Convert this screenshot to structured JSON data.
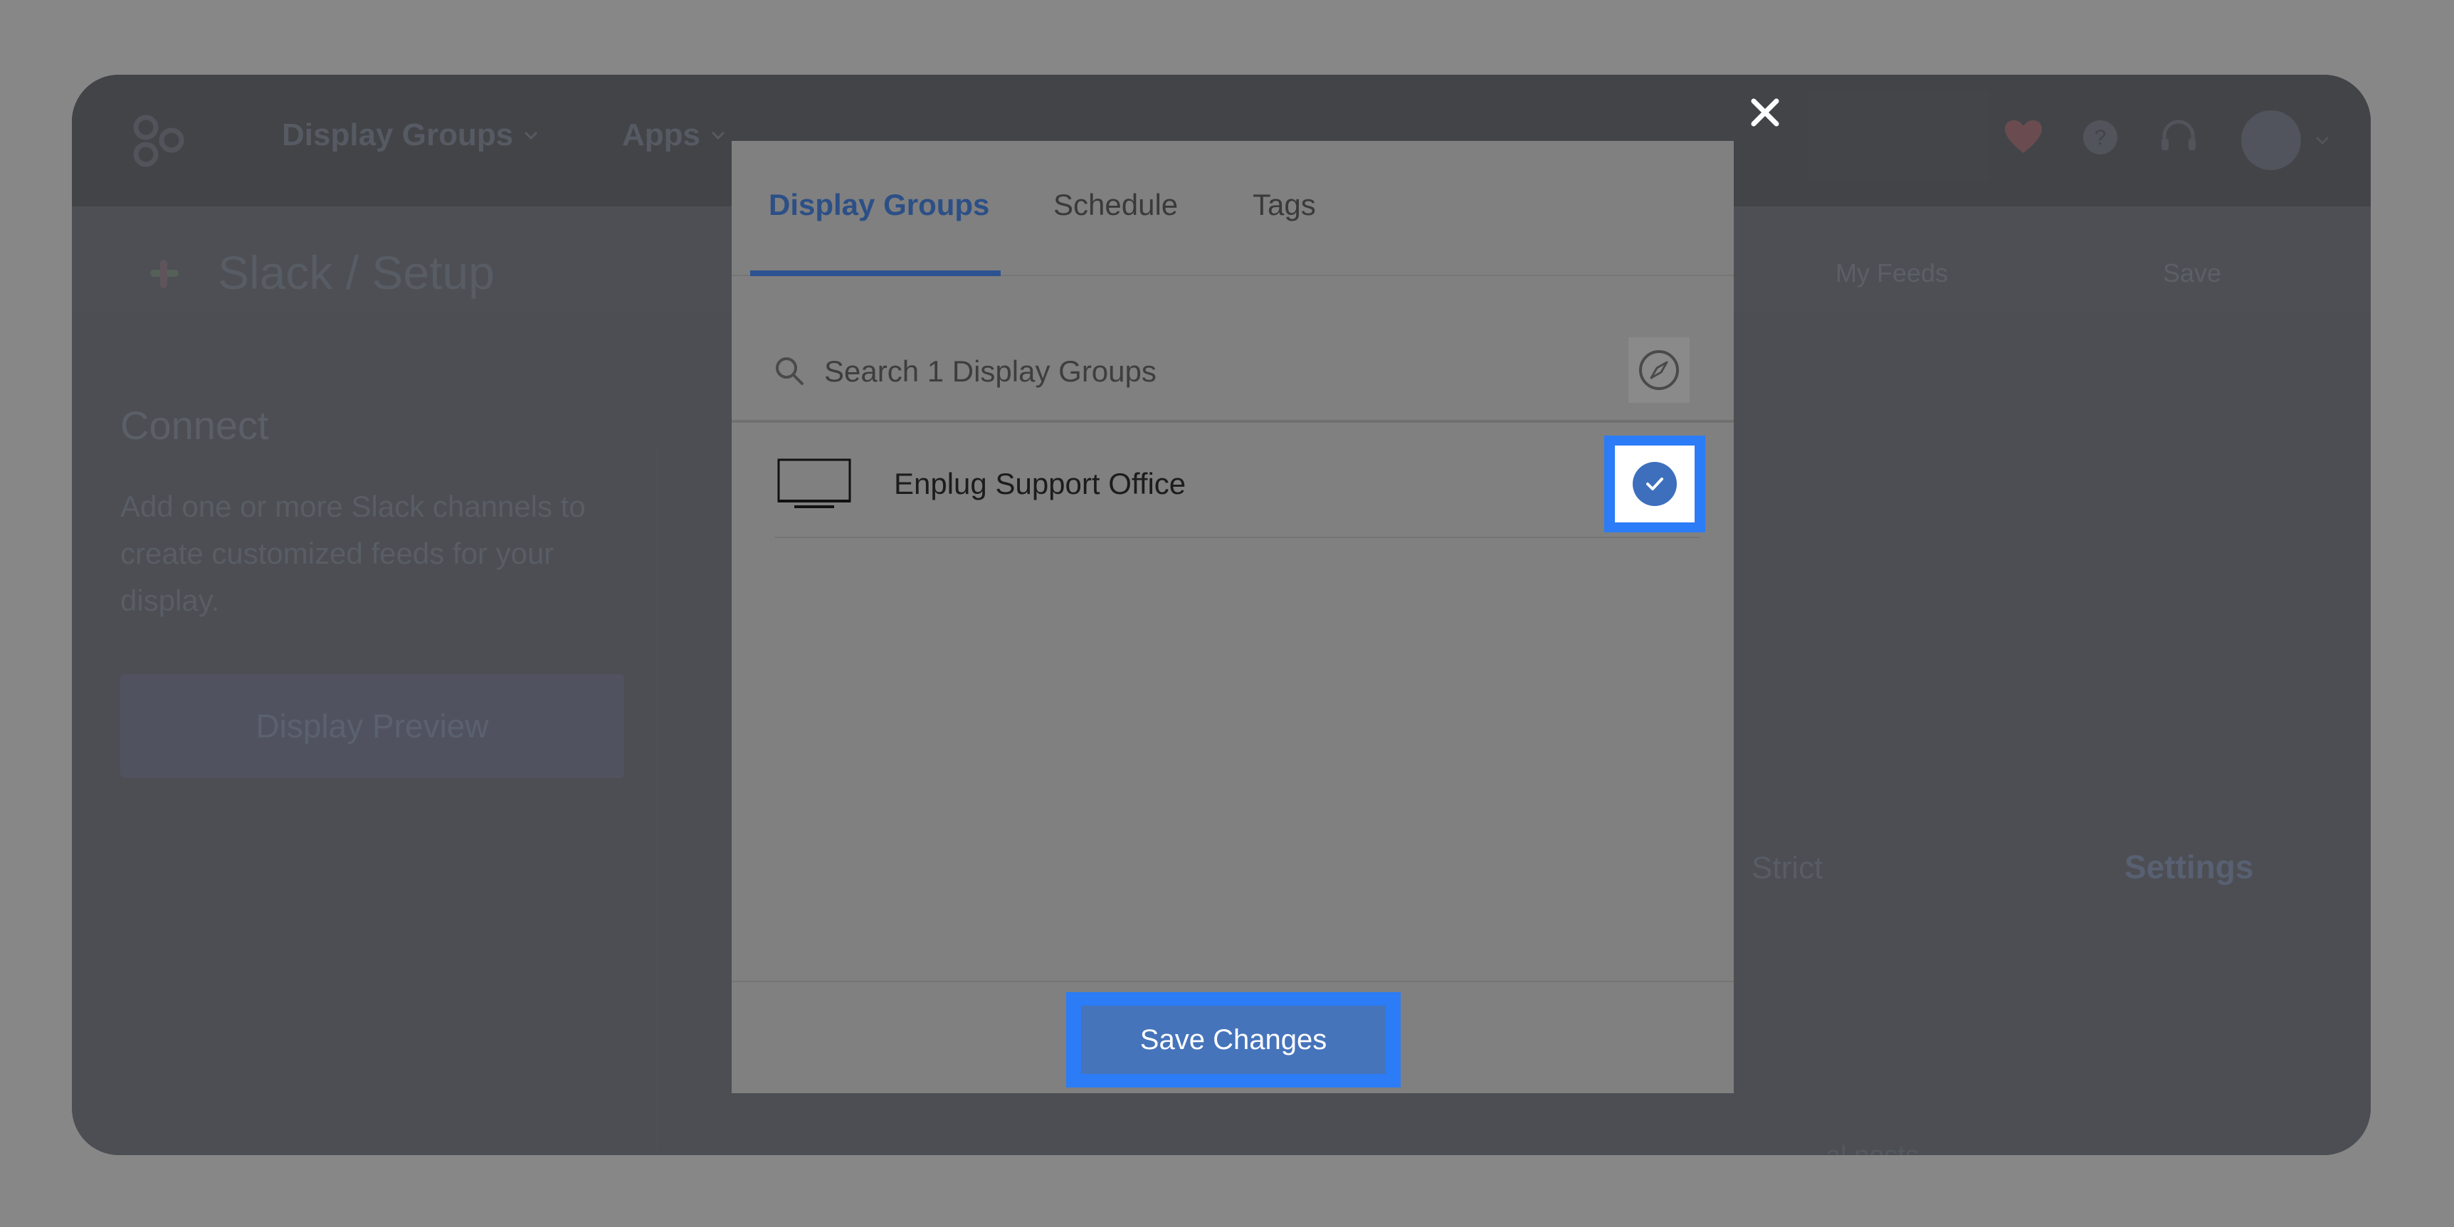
{
  "app": {
    "nav": {
      "display_groups": "Display Groups",
      "apps": "Apps"
    },
    "subheader": {
      "title": "Slack / Setup",
      "my_feeds": "My Feeds",
      "save": "Save"
    },
    "connect": {
      "title": "Connect",
      "description": "Add one or more Slack channels to create customized feeds for your display.",
      "preview_button": "Display Preview"
    },
    "strict_label": "Strict",
    "settings_label": "Settings",
    "posts_fragment": "al posts."
  },
  "modal": {
    "tabs": [
      {
        "label": "Display Groups",
        "active": true
      },
      {
        "label": "Schedule",
        "active": false
      },
      {
        "label": "Tags",
        "active": false
      }
    ],
    "search": {
      "placeholder": "Search 1 Display Groups"
    },
    "items": [
      {
        "label": "Enplug Support Office",
        "selected": true,
        "icon": "display-monitor-icon"
      }
    ],
    "save_button": "Save Changes"
  },
  "colors": {
    "accent_blue": "#2d5291",
    "highlight_blue": "#2b7cf6",
    "button_blue": "#4574bb"
  }
}
